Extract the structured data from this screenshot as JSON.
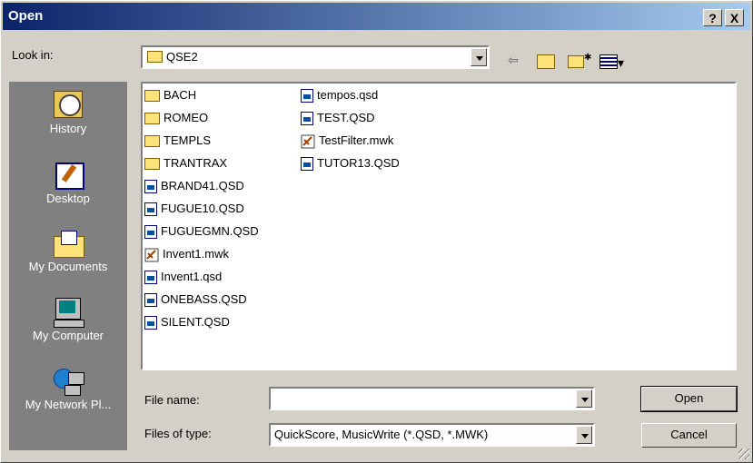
{
  "dialog": {
    "title": "Open",
    "help_button": "?",
    "close_button": "X"
  },
  "look_in": {
    "label": "Look in:",
    "value": "QSE2"
  },
  "places": [
    {
      "label": "History",
      "icon": "history-icon"
    },
    {
      "label": "Desktop",
      "icon": "desktop-icon"
    },
    {
      "label": "My Documents",
      "icon": "my-documents-icon"
    },
    {
      "label": "My Computer",
      "icon": "my-computer-icon"
    },
    {
      "label": "My Network Pl...",
      "icon": "my-network-places-icon"
    }
  ],
  "files": [
    {
      "name": "BACH",
      "type": "folder"
    },
    {
      "name": "ROMEO",
      "type": "folder"
    },
    {
      "name": "TEMPLS",
      "type": "folder"
    },
    {
      "name": "TRANTRAX",
      "type": "folder"
    },
    {
      "name": "BRAND41.QSD",
      "type": "qsd"
    },
    {
      "name": "FUGUE10.QSD",
      "type": "qsd"
    },
    {
      "name": "FUGUEGMN.QSD",
      "type": "qsd"
    },
    {
      "name": "Invent1.mwk",
      "type": "mwk"
    },
    {
      "name": "Invent1.qsd",
      "type": "qsd"
    },
    {
      "name": "ONEBASS.QSD",
      "type": "qsd"
    },
    {
      "name": "SILENT.QSD",
      "type": "qsd"
    },
    {
      "name": "tempos.qsd",
      "type": "qsd"
    },
    {
      "name": "TEST.QSD",
      "type": "qsd"
    },
    {
      "name": "TestFilter.mwk",
      "type": "mwk"
    },
    {
      "name": "TUTOR13.QSD",
      "type": "qsd"
    }
  ],
  "file_name": {
    "label": "File name:",
    "value": ""
  },
  "files_of_type": {
    "label": "Files of type:",
    "value": "QuickScore, MusicWrite (*.QSD, *.MWK)"
  },
  "buttons": {
    "open": "Open",
    "cancel": "Cancel"
  }
}
